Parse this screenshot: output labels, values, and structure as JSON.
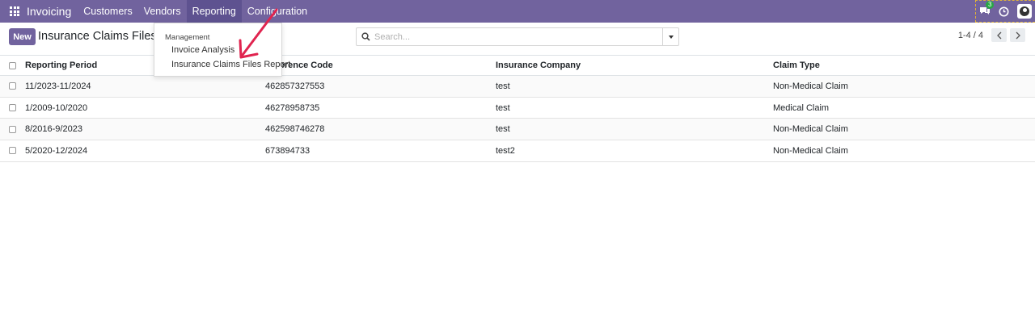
{
  "navbar": {
    "brand": "Invoicing",
    "menu": [
      "Customers",
      "Vendors",
      "Reporting",
      "Configuration"
    ],
    "active_menu": "Reporting",
    "chat_count": "3",
    "color": "#71639e"
  },
  "dropdown": {
    "header": "Management",
    "items": [
      "Invoice Analysis",
      "Insurance Claims Files Report"
    ]
  },
  "control_panel": {
    "new_label": "New",
    "title": "Insurance Claims Files Report",
    "search_placeholder": "Search...",
    "pager_value": "1-4 / 4"
  },
  "table": {
    "headers": [
      "Reporting Period",
      "Reference Code",
      "Insurance Company",
      "Claim Type"
    ],
    "rows": [
      [
        "11/2023-11/2024",
        "462857327553",
        "test",
        "Non-Medical Claim"
      ],
      [
        "1/2009-10/2020",
        "46278958735",
        "test",
        "Medical Claim"
      ],
      [
        "8/2016-9/2023",
        "462598746278",
        "test",
        "Non-Medical Claim"
      ],
      [
        "5/2020-12/2024",
        "673894733",
        "test2",
        "Non-Medical Claim"
      ]
    ]
  },
  "icons": {
    "apps": "apps-grid-icon",
    "chat": "chat-icon",
    "activity": "clock-icon",
    "search": "search-icon",
    "toggle": "caret-down-icon",
    "prev": "chevron-left-icon",
    "next": "chevron-right-icon"
  },
  "annotation_color": "#e0244f"
}
